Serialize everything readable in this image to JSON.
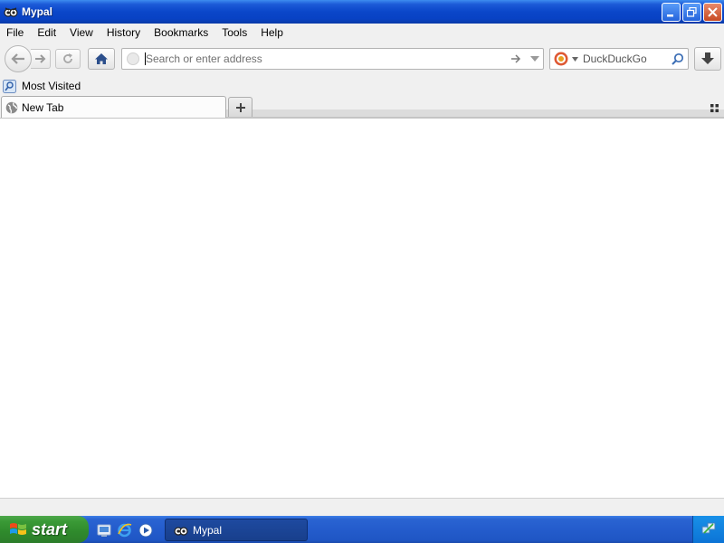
{
  "window": {
    "title": "Mypal"
  },
  "menubar": {
    "items": [
      {
        "label": "File"
      },
      {
        "label": "Edit"
      },
      {
        "label": "View"
      },
      {
        "label": "History"
      },
      {
        "label": "Bookmarks"
      },
      {
        "label": "Tools"
      },
      {
        "label": "Help"
      }
    ]
  },
  "navbar": {
    "url_placeholder": "Search or enter address",
    "url_value": "",
    "search_placeholder": "DuckDuckGo",
    "search_engine_icon": "duckduckgo-icon"
  },
  "bookmarks": {
    "items": [
      {
        "label": "Most Visited",
        "icon": "most-visited-icon"
      }
    ]
  },
  "tabs": [
    {
      "label": "New Tab",
      "active": true
    }
  ],
  "taskbar": {
    "start_label": "start",
    "quick_launch": [
      {
        "icon": "show-desktop-icon"
      },
      {
        "icon": "internet-explorer-icon"
      },
      {
        "icon": "media-player-icon"
      }
    ],
    "tasks": [
      {
        "label": "Mypal",
        "icon": "mypal-icon"
      }
    ]
  },
  "colors": {
    "titlebar": "#0842c4",
    "taskbar": "#245ccc",
    "start": "#3a9a36",
    "chrome": "#f0f0f0"
  }
}
